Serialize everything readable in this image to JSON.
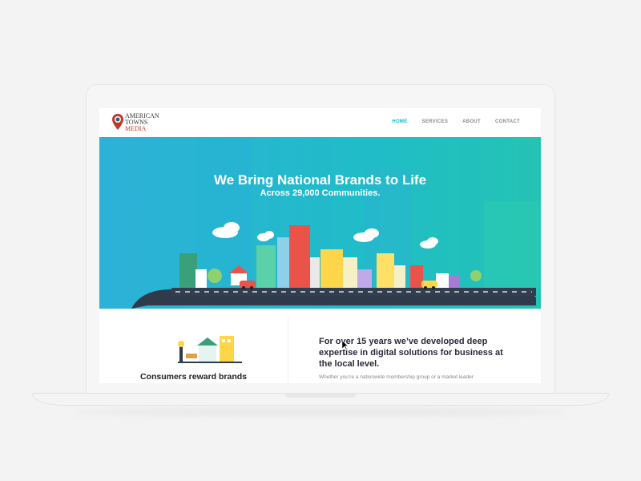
{
  "logo": {
    "line1": "AMERICAN",
    "line2": "TOWNS",
    "line3": "MEDIA"
  },
  "nav": [
    {
      "label": "HOME",
      "active": true
    },
    {
      "label": "SERVICES",
      "active": false
    },
    {
      "label": "ABOUT",
      "active": false
    },
    {
      "label": "CONTACT",
      "active": false
    }
  ],
  "hero": {
    "title": "We Bring National Brands to Life",
    "subtitle": "Across 29,000 Communities."
  },
  "section_left": {
    "heading": "Consumers reward brands"
  },
  "section_right": {
    "heading": "For over 15 years we’ve developed deep expertise in digital solutions for business at the local level.",
    "text": "Whether you’re a nationwide membership group or a market leader"
  },
  "colors": {
    "accent": "#18b4c6",
    "logo_red": "#c0392b",
    "hero": "#22b8cc"
  }
}
